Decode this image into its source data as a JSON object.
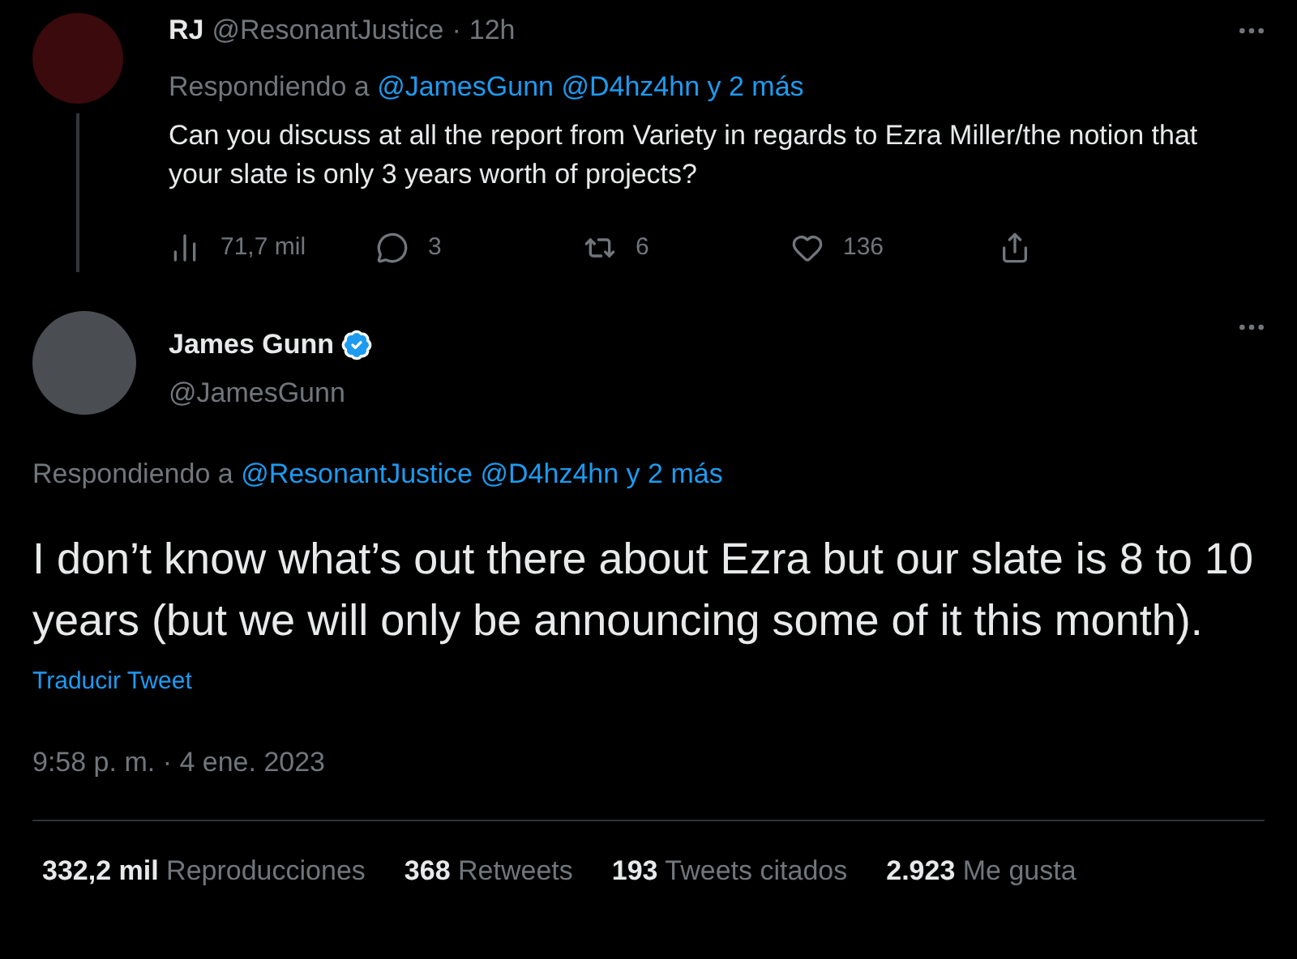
{
  "parent_tweet": {
    "name": "RJ",
    "handle": "@ResonantJustice",
    "separator": "·",
    "time": "12h",
    "replying_prefix": "Respondiendo a",
    "replying_links": [
      "@JamesGunn",
      "@D4hz4hn",
      "y 2 más"
    ],
    "text": "Can you discuss at all the report from Variety in regards to Ezra Miller/the notion that your slate is only 3 years worth of projects?",
    "actions": [
      {
        "kind": "views",
        "count": "71,7 mil"
      },
      {
        "kind": "reply",
        "count": "3"
      },
      {
        "kind": "retweet",
        "count": "6"
      },
      {
        "kind": "like",
        "count": "136"
      },
      {
        "kind": "share"
      }
    ]
  },
  "main_tweet": {
    "name": "James Gunn",
    "verified": true,
    "handle": "@JamesGunn",
    "replying_prefix": "Respondiendo a",
    "replying_links": [
      "@ResonantJustice",
      "@D4hz4hn",
      "y 2 más"
    ],
    "text": "I don’t know what’s out there about Ezra but our slate is 8 to 10 years (but we will only be announcing some of it this month).",
    "translate": "Traducir Tweet",
    "timestamp": "9:58 p. m. · 4 ene. 2023",
    "stats": [
      "**332,2 mil** Reproducciones",
      "**368** Retweets",
      "**193** Tweets citados",
      "**2.923** Me gusta"
    ]
  }
}
